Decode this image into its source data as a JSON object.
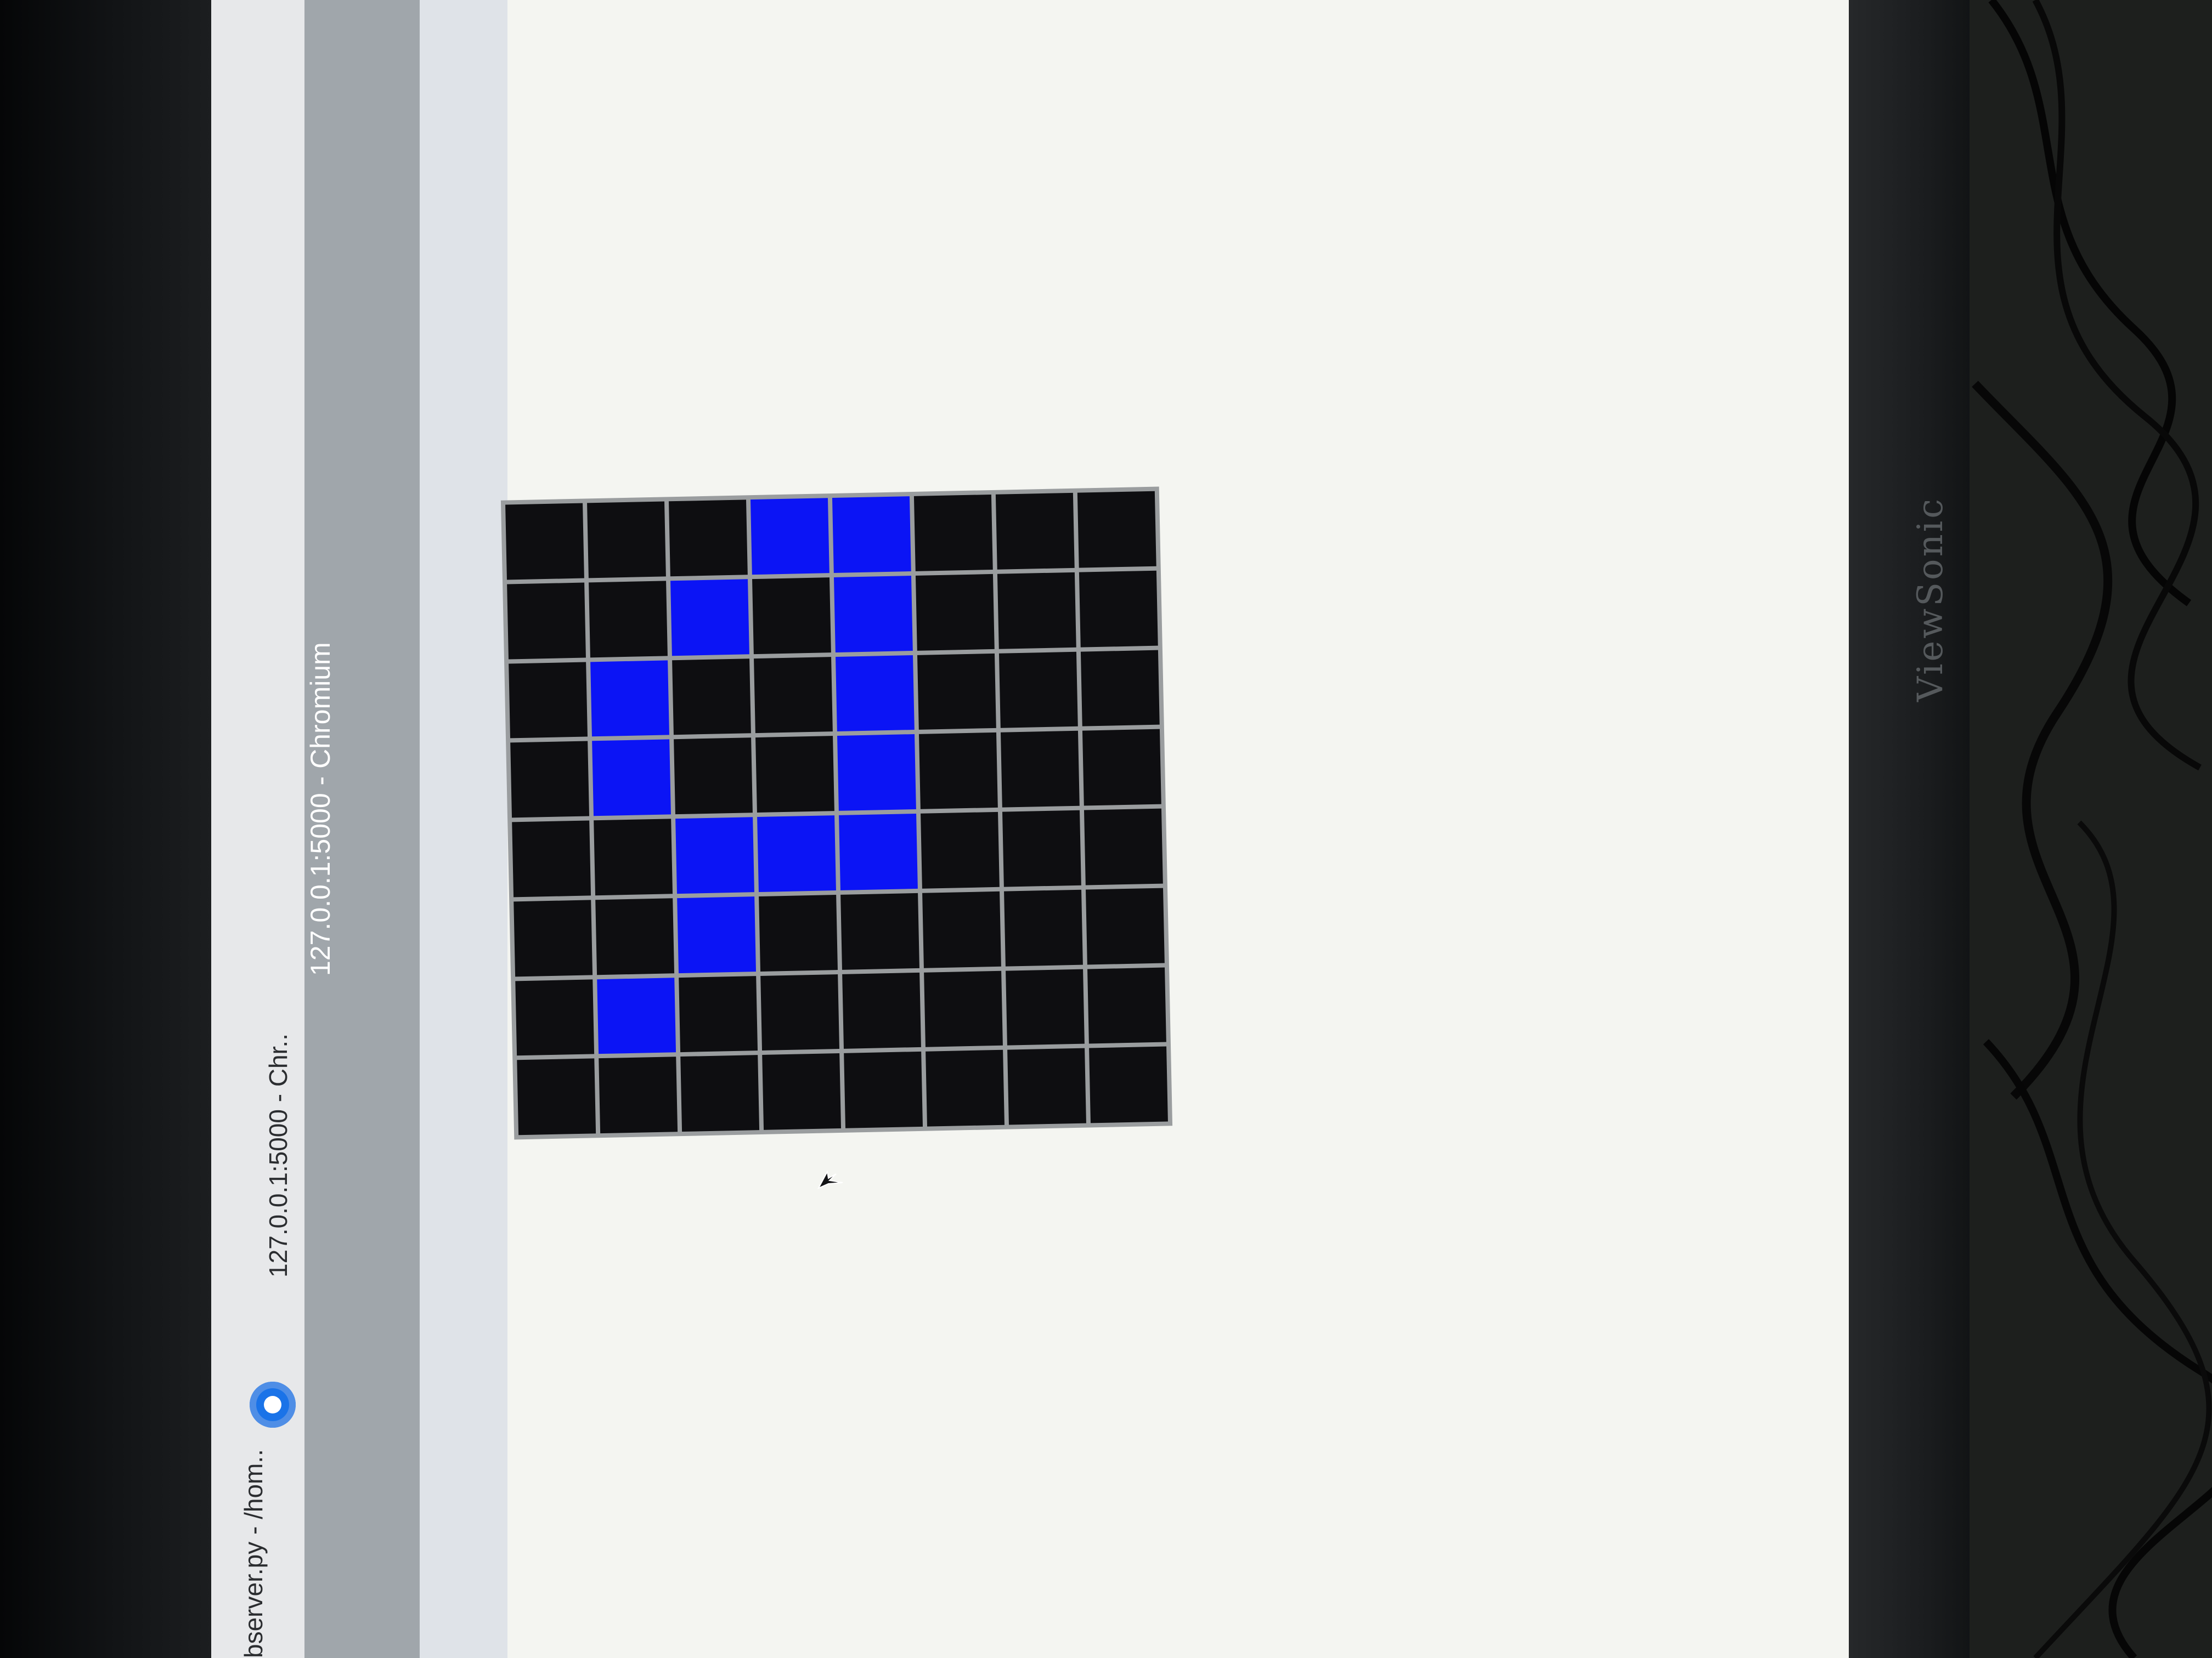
{
  "taskbar": {
    "items": [
      {
        "label": "bserver.py - /hom.."
      },
      {
        "label": "127.0.0.1:5000 - Chr.."
      }
    ],
    "chrome_icon": "chromium-icon"
  },
  "window": {
    "title": "127.0.0.1:5000 - Chromium"
  },
  "monitor": {
    "brand": "ViewSonic"
  },
  "grid": {
    "rows": 8,
    "cols": 8,
    "on_color": "#0b14f5",
    "off_color": "#0e0e11",
    "line_color": "#9a9d9f",
    "cells": [
      [
        0,
        0,
        0,
        1,
        1,
        0,
        0,
        0
      ],
      [
        0,
        0,
        1,
        0,
        1,
        0,
        0,
        0
      ],
      [
        0,
        1,
        0,
        0,
        1,
        0,
        0,
        0
      ],
      [
        0,
        1,
        0,
        0,
        1,
        0,
        0,
        0
      ],
      [
        0,
        0,
        1,
        1,
        1,
        0,
        0,
        0
      ],
      [
        0,
        0,
        1,
        0,
        0,
        0,
        0,
        0
      ],
      [
        0,
        1,
        0,
        0,
        0,
        0,
        0,
        0
      ],
      [
        0,
        0,
        0,
        0,
        0,
        0,
        0,
        0
      ]
    ]
  },
  "cursor": {
    "icon": "mouse-pointer-icon"
  }
}
